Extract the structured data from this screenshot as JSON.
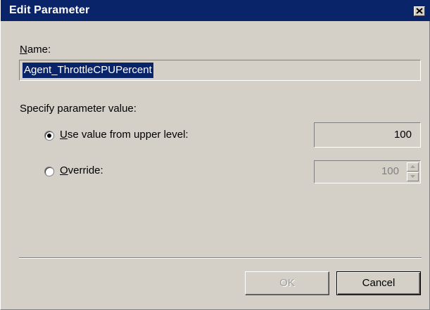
{
  "window": {
    "title": "Edit Parameter",
    "close_icon": "close-icon"
  },
  "name_section": {
    "label": "Name:",
    "value": "Agent_ThrottleCPUPercent"
  },
  "specify": {
    "label": "Specify parameter value:",
    "options": [
      {
        "label": "Use value from upper level:",
        "selected": true,
        "value": "100"
      },
      {
        "label": "Override:",
        "selected": false,
        "value": "100"
      }
    ]
  },
  "buttons": {
    "ok_label": "OK",
    "cancel_label": "Cancel"
  },
  "colors": {
    "titlebar": "#0a246a",
    "dialog_bg": "#d4d0c8",
    "selection": "#0a246a"
  }
}
